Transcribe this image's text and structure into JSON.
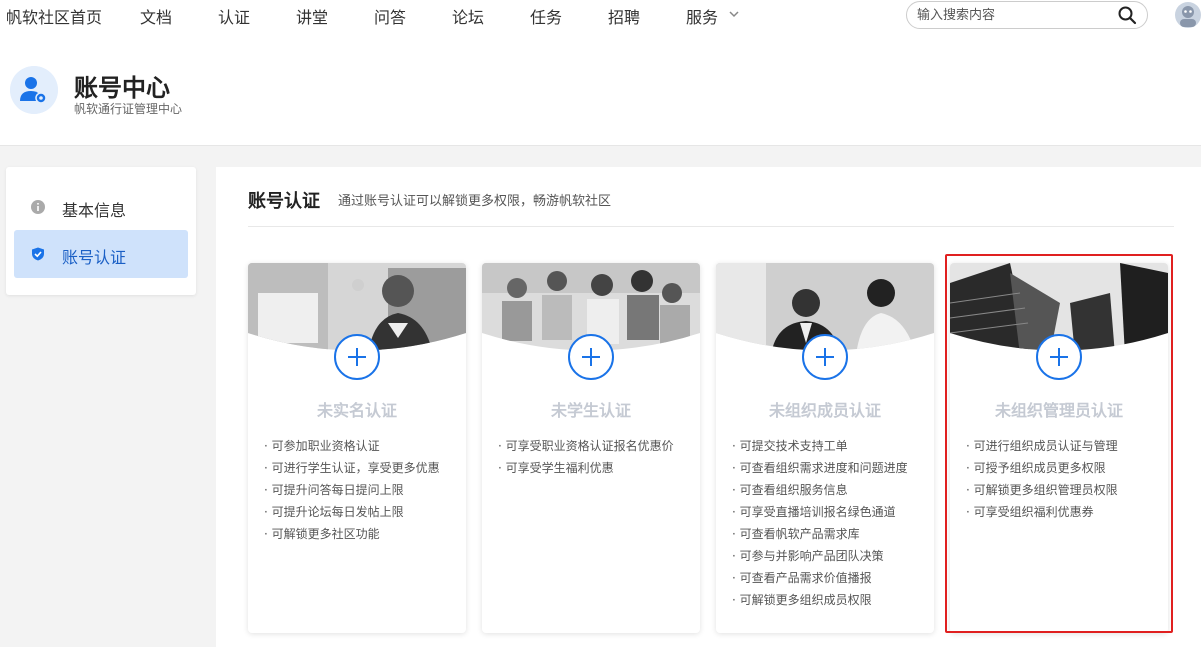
{
  "nav": {
    "brand": "帆软社区首页",
    "items": [
      "文档",
      "认证",
      "讲堂",
      "问答",
      "论坛",
      "任务",
      "招聘",
      "服务"
    ],
    "search_placeholder": "输入搜索内容"
  },
  "header": {
    "title": "账号中心",
    "subtitle": "帆软通行证管理中心"
  },
  "sidebar": {
    "items": [
      {
        "label": "基本信息",
        "icon": "info-icon"
      },
      {
        "label": "账号认证",
        "icon": "shield-check-icon",
        "active": true
      }
    ]
  },
  "main": {
    "title": "账号认证",
    "subtitle": "通过账号认证可以解锁更多权限，畅游帆软社区",
    "cards": [
      {
        "title": "未实名认证",
        "benefits": [
          "可参加职业资格认证",
          "可进行学生认证，享受更多优惠",
          "可提升问答每日提问上限",
          "可提升论坛每日发帖上限",
          "可解锁更多社区功能"
        ]
      },
      {
        "title": "未学生认证",
        "benefits": [
          "可享受职业资格认证报名优惠价",
          "可享受学生福利优惠"
        ]
      },
      {
        "title": "未组织成员认证",
        "benefits": [
          "可提交技术支持工单",
          "可查看组织需求进度和问题进度",
          "可查看组织服务信息",
          "可享受直播培训报名绿色通道",
          "可查看帆软产品需求库",
          "可参与并影响产品团队决策",
          "可查看产品需求价值播报",
          "可解锁更多组织成员权限"
        ]
      },
      {
        "title": "未组织管理员认证",
        "benefits": [
          "可进行组织成员认证与管理",
          "可授予组织成员更多权限",
          "可解锁更多组织管理员权限",
          "可享受组织福利优惠券"
        ]
      }
    ]
  },
  "colors": {
    "accent": "#1a73e8",
    "active_bg": "#cfe2fb",
    "highlight": "#e02020"
  }
}
